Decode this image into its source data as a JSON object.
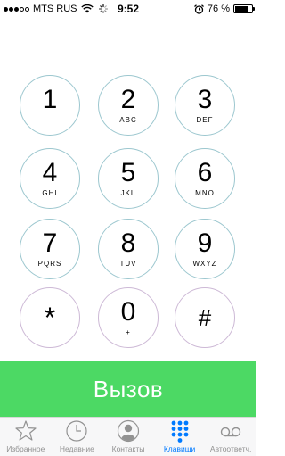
{
  "status_bar": {
    "carrier": "MTS RUS",
    "time": "9:52",
    "battery_percent": "76 %",
    "battery_level": 0.76,
    "signal_bars_filled": 3,
    "signal_bars_total": 5
  },
  "keypad": {
    "keys": [
      {
        "digit": "1",
        "letters": ""
      },
      {
        "digit": "2",
        "letters": "ABC"
      },
      {
        "digit": "3",
        "letters": "DEF"
      },
      {
        "digit": "4",
        "letters": "GHI"
      },
      {
        "digit": "5",
        "letters": "JKL"
      },
      {
        "digit": "6",
        "letters": "MNO"
      },
      {
        "digit": "7",
        "letters": "PQRS"
      },
      {
        "digit": "8",
        "letters": "TUV"
      },
      {
        "digit": "9",
        "letters": "WXYZ"
      },
      {
        "digit": "*",
        "letters": ""
      },
      {
        "digit": "0",
        "letters": "+"
      },
      {
        "digit": "#",
        "letters": ""
      }
    ]
  },
  "call_button": {
    "label": "Вызов",
    "color": "#4cd964"
  },
  "tab_bar": {
    "active_color": "#007aff",
    "tabs": [
      {
        "label": "Избранное",
        "icon": "star-icon"
      },
      {
        "label": "Недавние",
        "icon": "clock-icon"
      },
      {
        "label": "Контакты",
        "icon": "contact-icon"
      },
      {
        "label": "Клавиши",
        "icon": "keypad-icon",
        "active": true
      },
      {
        "label": "Автоответч.",
        "icon": "voicemail-icon"
      }
    ]
  }
}
